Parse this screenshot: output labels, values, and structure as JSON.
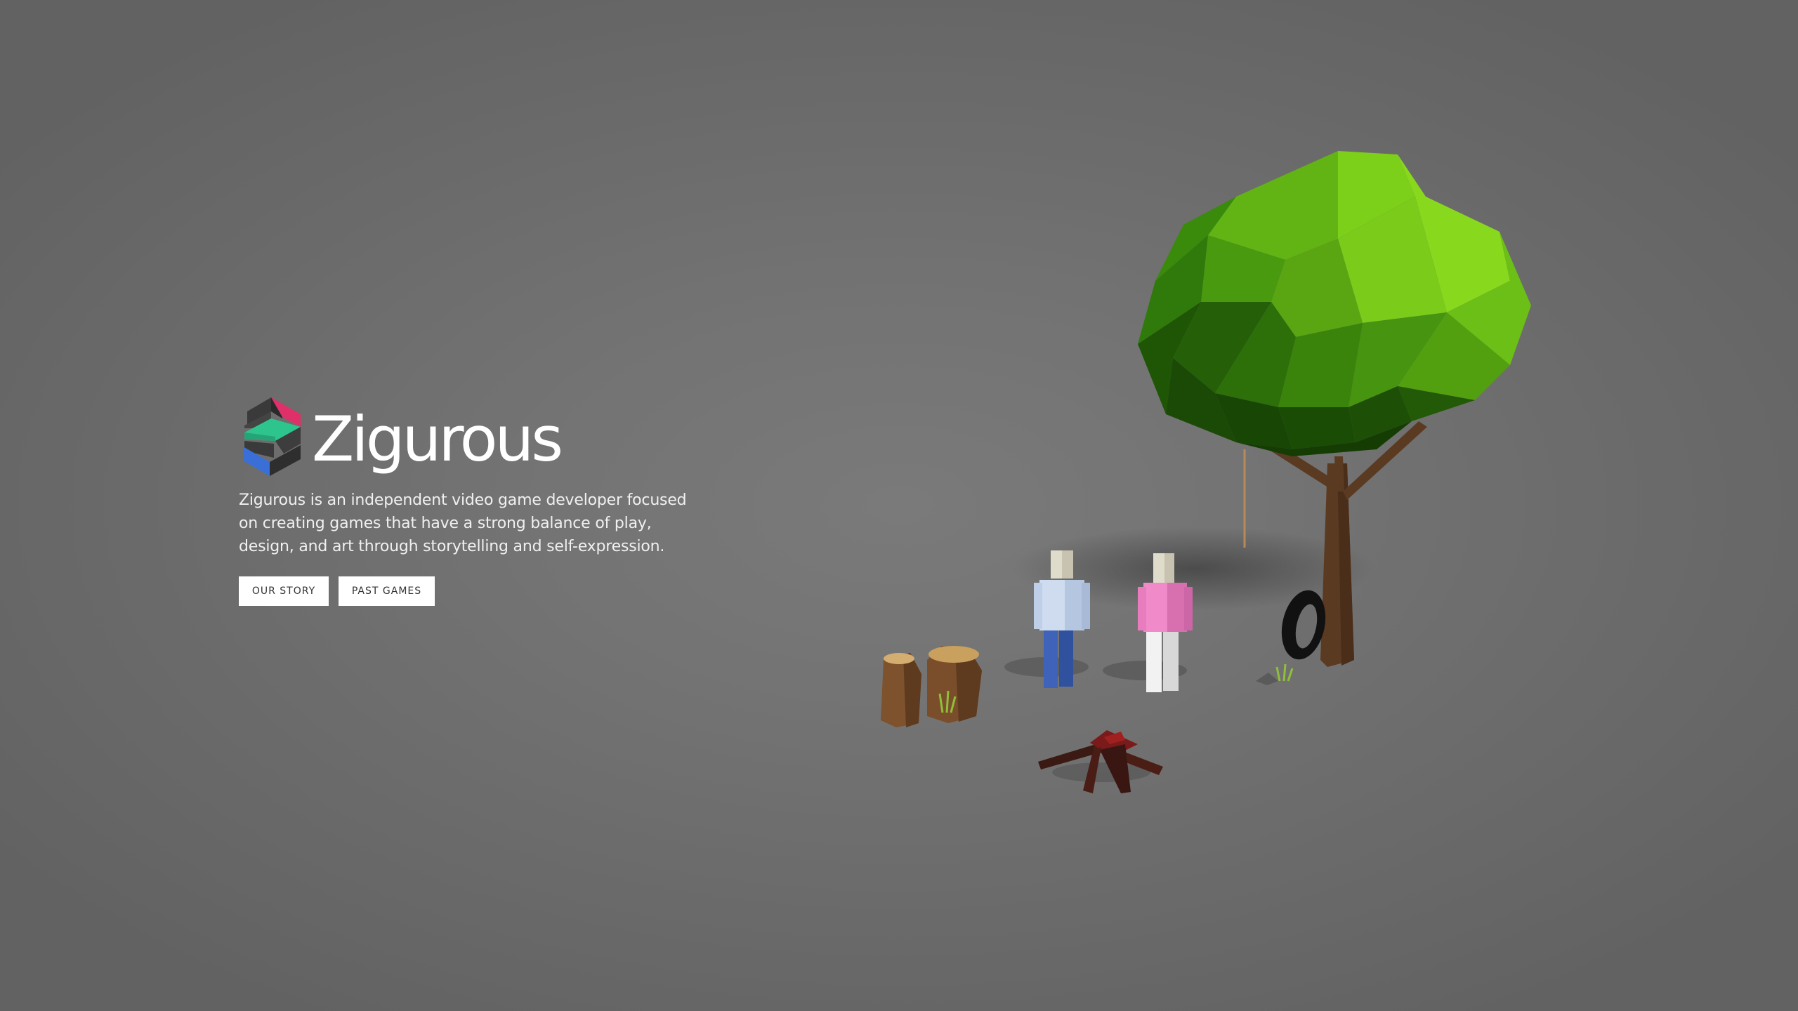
{
  "brand": {
    "name": "Zigurous",
    "logo_icon": "zigurous-logo-icon",
    "colors": {
      "logo_pink": "#e0306a",
      "logo_green": "#2ec48d",
      "logo_blue": "#3a6fd8",
      "logo_dark": "#333333"
    }
  },
  "hero": {
    "tagline": "Zigurous is an independent video game developer focused on creating games that have a strong balance of play, design, and art through storytelling and self-expression."
  },
  "buttons": {
    "our_story": "OUR STORY",
    "past_games": "PAST GAMES"
  },
  "scene": {
    "icon": "low-poly-campsite-scene"
  }
}
